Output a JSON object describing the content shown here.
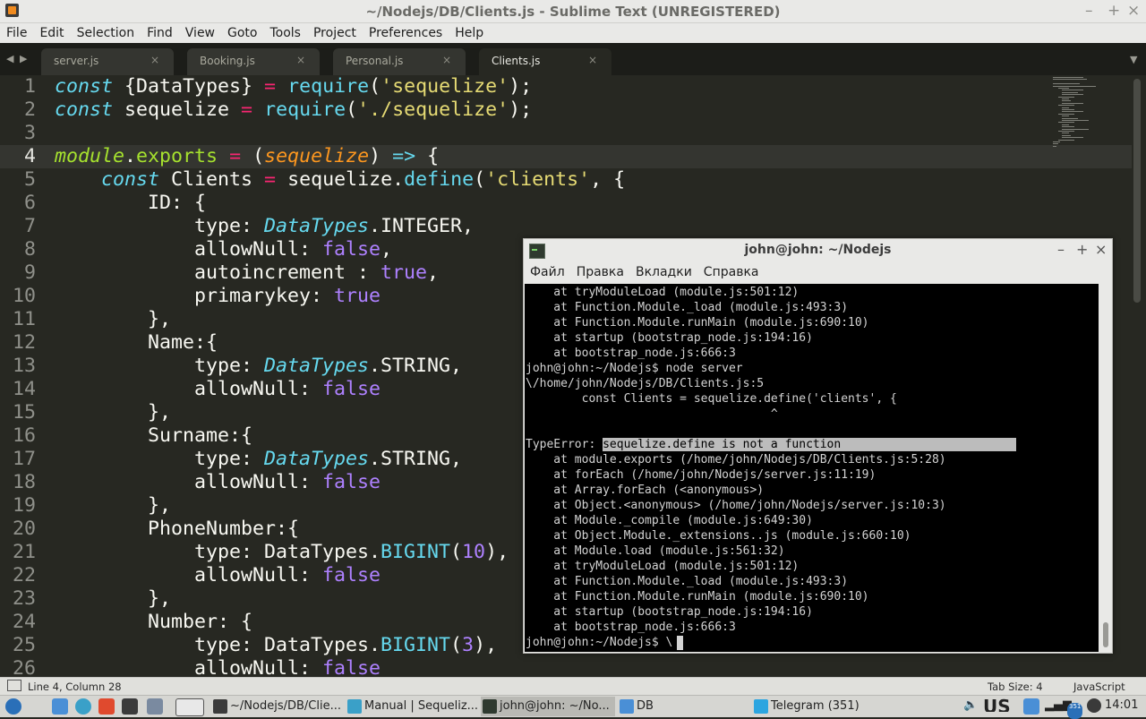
{
  "window": {
    "title": "~/Nodejs/DB/Clients.js - Sublime Text (UNREGISTERED)",
    "controls": [
      "–",
      "+",
      "×"
    ]
  },
  "menu": [
    "File",
    "Edit",
    "Selection",
    "Find",
    "View",
    "Goto",
    "Tools",
    "Project",
    "Preferences",
    "Help"
  ],
  "tabs": [
    {
      "label": "server.js",
      "active": false
    },
    {
      "label": "Booking.js",
      "active": false
    },
    {
      "label": "Personal.js",
      "active": false
    },
    {
      "label": "Clients.js",
      "active": true
    }
  ],
  "tab_close_glyph": "×",
  "editor": {
    "current_line": 4,
    "lines": [
      {
        "n": "1",
        "toks": [
          [
            "const",
            "kw"
          ],
          [
            " {DataTypes} ",
            ""
          ],
          [
            "=",
            "op"
          ],
          [
            " ",
            ""
          ],
          [
            "require",
            "fn"
          ],
          [
            "(",
            ""
          ],
          [
            "'sequelize'",
            "str"
          ],
          [
            ");",
            ""
          ]
        ]
      },
      {
        "n": "2",
        "toks": [
          [
            "const",
            "kw"
          ],
          [
            " sequelize ",
            ""
          ],
          [
            "=",
            "op"
          ],
          [
            " ",
            ""
          ],
          [
            "require",
            "fn"
          ],
          [
            "(",
            ""
          ],
          [
            "'./sequelize'",
            "str"
          ],
          [
            ");",
            ""
          ]
        ]
      },
      {
        "n": "3",
        "toks": []
      },
      {
        "n": "4",
        "toks": [
          [
            "module",
            "mod"
          ],
          [
            ".",
            ""
          ],
          [
            "exports",
            "prp"
          ],
          [
            " ",
            ""
          ],
          [
            "=",
            "op"
          ],
          [
            " (",
            ""
          ],
          [
            "sequelize",
            "prm"
          ],
          [
            ") ",
            ""
          ],
          [
            "=>",
            "kw"
          ],
          [
            " {",
            ""
          ]
        ]
      },
      {
        "n": "5",
        "toks": [
          [
            "    ",
            ""
          ],
          [
            "const",
            "kw"
          ],
          [
            " Clients ",
            ""
          ],
          [
            "=",
            "op"
          ],
          [
            " sequelize.",
            ""
          ],
          [
            "define",
            "fn"
          ],
          [
            "(",
            ""
          ],
          [
            "'clients'",
            "str"
          ],
          [
            ", {",
            ""
          ]
        ]
      },
      {
        "n": "6",
        "toks": [
          [
            "        ID: {",
            ""
          ]
        ]
      },
      {
        "n": "7",
        "toks": [
          [
            "            type: ",
            ""
          ],
          [
            "DataTypes",
            "cls"
          ],
          [
            ".INTEGER,",
            ""
          ]
        ]
      },
      {
        "n": "8",
        "toks": [
          [
            "            allowNull: ",
            ""
          ],
          [
            "false",
            "num"
          ],
          [
            ",",
            ""
          ]
        ]
      },
      {
        "n": "9",
        "toks": [
          [
            "            autoincrement : ",
            ""
          ],
          [
            "true",
            "num"
          ],
          [
            ",",
            ""
          ]
        ]
      },
      {
        "n": "10",
        "toks": [
          [
            "            primarykey: ",
            ""
          ],
          [
            "true",
            "num"
          ]
        ]
      },
      {
        "n": "11",
        "toks": [
          [
            "        },",
            ""
          ]
        ]
      },
      {
        "n": "12",
        "toks": [
          [
            "        Name:{",
            ""
          ]
        ]
      },
      {
        "n": "13",
        "toks": [
          [
            "            type: ",
            ""
          ],
          [
            "DataTypes",
            "cls"
          ],
          [
            ".STRING,",
            ""
          ]
        ]
      },
      {
        "n": "14",
        "toks": [
          [
            "            allowNull: ",
            ""
          ],
          [
            "false",
            "num"
          ]
        ]
      },
      {
        "n": "15",
        "toks": [
          [
            "        },",
            ""
          ]
        ]
      },
      {
        "n": "16",
        "toks": [
          [
            "        Surname:{",
            ""
          ]
        ]
      },
      {
        "n": "17",
        "toks": [
          [
            "            type: ",
            ""
          ],
          [
            "DataTypes",
            "cls"
          ],
          [
            ".STRING,",
            ""
          ]
        ]
      },
      {
        "n": "18",
        "toks": [
          [
            "            allowNull: ",
            ""
          ],
          [
            "false",
            "num"
          ]
        ]
      },
      {
        "n": "19",
        "toks": [
          [
            "        },",
            ""
          ]
        ]
      },
      {
        "n": "20",
        "toks": [
          [
            "        PhoneNumber:{",
            ""
          ]
        ]
      },
      {
        "n": "21",
        "toks": [
          [
            "            type: DataTypes.",
            ""
          ],
          [
            "BIGINT",
            "fn"
          ],
          [
            "(",
            ""
          ],
          [
            "10",
            "num"
          ],
          [
            "),",
            ""
          ]
        ]
      },
      {
        "n": "22",
        "toks": [
          [
            "            allowNull: ",
            ""
          ],
          [
            "false",
            "num"
          ]
        ]
      },
      {
        "n": "23",
        "toks": [
          [
            "        },",
            ""
          ]
        ]
      },
      {
        "n": "24",
        "toks": [
          [
            "        Number: {",
            ""
          ]
        ]
      },
      {
        "n": "25",
        "toks": [
          [
            "            type: DataTypes.",
            ""
          ],
          [
            "BIGINT",
            "fn"
          ],
          [
            "(",
            ""
          ],
          [
            "3",
            "num"
          ],
          [
            "),",
            ""
          ]
        ]
      },
      {
        "n": "26",
        "toks": [
          [
            "            allowNull: ",
            ""
          ],
          [
            "false",
            "num"
          ]
        ]
      }
    ]
  },
  "status": {
    "position": "Line 4, Column 28",
    "tab_size": "Tab Size: 4",
    "syntax": "JavaScript"
  },
  "terminal": {
    "title": "john@john: ~/Nodejs",
    "controls": [
      "–",
      "+",
      "×"
    ],
    "menu": [
      "Файл",
      "Правка",
      "Вкладки",
      "Справка"
    ],
    "lines": [
      "    at tryModuleLoad (module.js:501:12)",
      "    at Function.Module._load (module.js:493:3)",
      "    at Function.Module.runMain (module.js:690:10)",
      "    at startup (bootstrap_node.js:194:16)",
      "    at bootstrap_node.js:666:3",
      "john@john:~/Nodejs$ node server",
      "\\/home/john/Nodejs/DB/Clients.js:5",
      "        const Clients = sequelize.define('clients', {",
      "                                   ^",
      "",
      "TypeError: |sequelize.define is not a function",
      "    at module.exports (/home/john/Nodejs/DB/Clients.js:5:28)",
      "    at forEach (/home/john/Nodejs/server.js:11:19)",
      "    at Array.forEach (<anonymous>)",
      "    at Object.<anonymous> (/home/john/Nodejs/server.js:10:3)",
      "    at Module._compile (module.js:649:30)",
      "    at Object.Module._extensions..js (module.js:660:10)",
      "    at Module.load (module.js:561:32)",
      "    at tryModuleLoad (module.js:501:12)",
      "    at Function.Module._load (module.js:493:3)",
      "    at Function.Module.runMain (module.js:690:10)",
      "    at startup (bootstrap_node.js:194:16)",
      "    at bootstrap_node.js:666:3",
      "john@john:~/Nodejs$ \\"
    ],
    "highlight_line": 10
  },
  "taskbar": {
    "tasks": [
      {
        "label": "~/Nodejs/DB/Clie...",
        "icon": "sublime-icon",
        "color": "#3b3b3b"
      },
      {
        "label": "Manual | Sequeliz...",
        "icon": "browser-icon",
        "color": "#3aa0c8"
      },
      {
        "label": "john@john: ~/No...",
        "icon": "terminal-icon",
        "color": "#2f3a2f",
        "active": true
      },
      {
        "label": "DB",
        "icon": "folder-icon",
        "color": "#4a8fd6"
      },
      {
        "label": "Telegram (351)",
        "icon": "telegram-icon",
        "color": "#2ca5e0"
      }
    ],
    "keyboard_layout": "US",
    "badge": "351",
    "clock": "14:01"
  }
}
